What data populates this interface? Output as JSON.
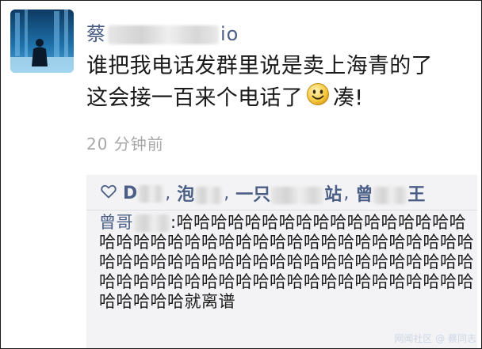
{
  "post": {
    "author_prefix": "蔡",
    "author_suffix": "io",
    "text_line1": "谁把我电话发群里说是卖上海青的了",
    "text_line2_pre": "这会接一百来个电话了",
    "text_line2_post": "凑!",
    "emoji_icon": "smiley-emoji-icon",
    "timestamp": "20 分钟前"
  },
  "likes": {
    "icon": "heart-outline-icon",
    "names": [
      {
        "visible": "D",
        "hidden_width": "blur"
      },
      {
        "visible": "泡",
        "hidden_width": "blur"
      },
      {
        "visible": "一只",
        "hidden_width": "blur",
        "tail": "站"
      },
      {
        "visible": "曾",
        "hidden_width": "blur",
        "tail": "王"
      }
    ],
    "separator": ","
  },
  "comment": {
    "author_visible": "曾哥",
    "colon": ":",
    "text": "哈哈哈哈哈哈哈哈哈哈哈哈哈哈哈哈哈哈哈哈哈哈哈哈哈哈哈哈哈哈哈哈哈哈哈哈哈哈哈哈哈哈哈哈哈哈哈哈哈哈哈哈哈哈哈哈哈哈哈哈哈哈哈哈哈哈哈哈哈哈哈哈哈哈哈哈哈哈哈哈哈哈哈哈哈哈哈哈就离谱"
  },
  "watermark": "网闻社区 @ 蔡同志",
  "colors": {
    "name_blue": "#4a5e86",
    "text": "#1b1b1b",
    "muted": "#a8a8a8",
    "comment_bg": "#f3f3f5"
  }
}
